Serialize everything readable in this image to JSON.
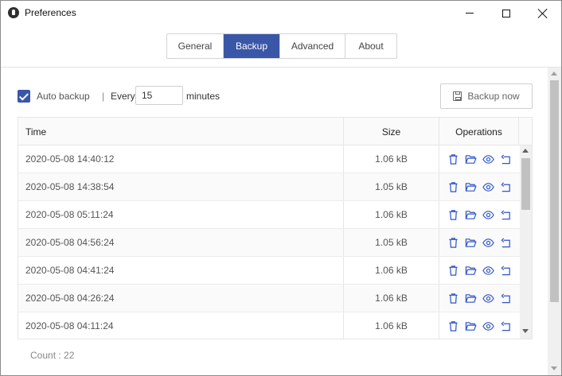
{
  "window": {
    "title": "Preferences"
  },
  "tabs": [
    {
      "label": "General",
      "active": false
    },
    {
      "label": "Backup",
      "active": true
    },
    {
      "label": "Advanced",
      "active": false
    },
    {
      "label": "About",
      "active": false
    }
  ],
  "controls": {
    "auto_backup_label": "Auto backup",
    "auto_backup_checked": true,
    "separator": "|",
    "every_label": "Every",
    "interval_value": "15",
    "minutes_label": "minutes",
    "backup_now_label": "Backup now"
  },
  "table": {
    "columns": [
      "Time",
      "Size",
      "Operations"
    ],
    "rows": [
      {
        "time": "2020-05-08 14:40:12",
        "size": "1.06 kB"
      },
      {
        "time": "2020-05-08 14:38:54",
        "size": "1.05 kB"
      },
      {
        "time": "2020-05-08 05:11:24",
        "size": "1.06 kB"
      },
      {
        "time": "2020-05-08 04:56:24",
        "size": "1.05 kB"
      },
      {
        "time": "2020-05-08 04:41:24",
        "size": "1.06 kB"
      },
      {
        "time": "2020-05-08 04:26:24",
        "size": "1.06 kB"
      },
      {
        "time": "2020-05-08 04:11:24",
        "size": "1.06 kB"
      }
    ],
    "operation_icons": [
      "trash-icon",
      "folder-open-icon",
      "eye-icon",
      "restore-icon"
    ]
  },
  "footer": {
    "count": "Count : 22"
  },
  "colors": {
    "accent": "#3a57a7",
    "icon_blue": "#2f54c8"
  }
}
